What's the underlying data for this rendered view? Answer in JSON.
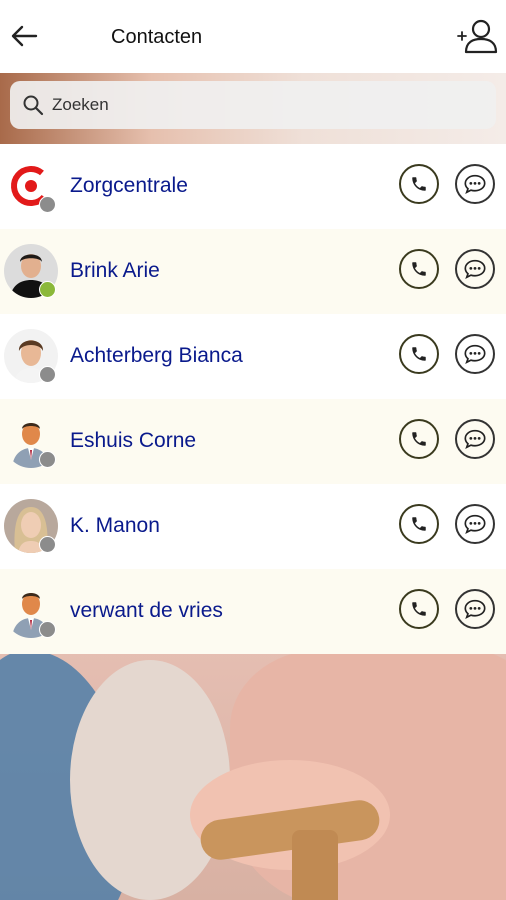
{
  "header": {
    "title": "Contacten",
    "back_icon": "arrow-left-icon",
    "add_icon": "add-contact-icon"
  },
  "search": {
    "placeholder": "Zoeken",
    "value": ""
  },
  "status_colors": {
    "online": "#8bb83a",
    "offline": "#8c8c8c"
  },
  "contacts": [
    {
      "name": "Zorgcentrale",
      "avatar": "zorgcentrale-logo",
      "status": "offline"
    },
    {
      "name": "Brink Arie",
      "avatar": "photo-man-dark-hair",
      "status": "online"
    },
    {
      "name": "Achterberg Bianca",
      "avatar": "photo-woman-short-hair",
      "status": "offline"
    },
    {
      "name": "Eshuis Corne",
      "avatar": "default-person-icon",
      "status": "offline"
    },
    {
      "name": "K. Manon",
      "avatar": "photo-woman-blonde",
      "status": "offline"
    },
    {
      "name": "verwant de vries",
      "avatar": "default-person-icon",
      "status": "offline"
    }
  ]
}
